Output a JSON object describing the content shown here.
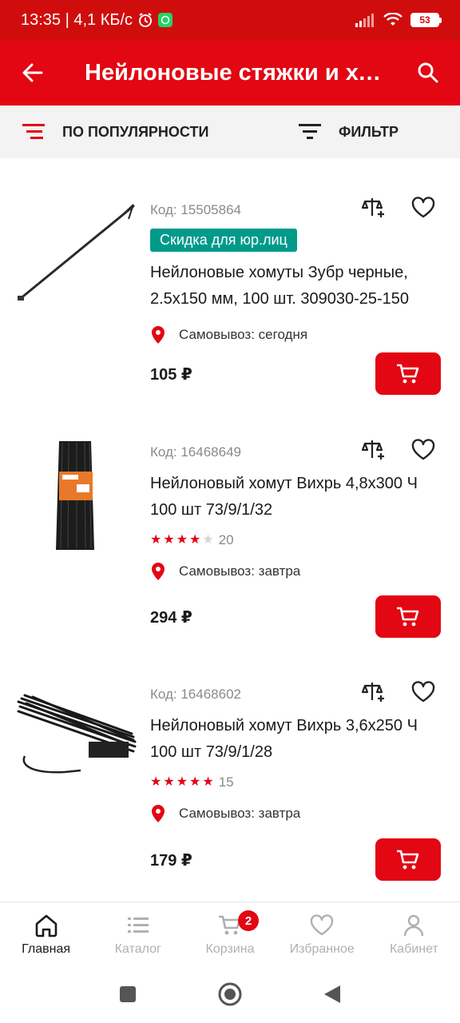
{
  "status_bar": {
    "time_speed": "13:35 | 4,1 КБ/с",
    "battery": "53"
  },
  "app_bar": {
    "title": "Нейлоновые стяжки и хо…",
    "back_icon": "arrow-back-icon",
    "search_icon": "search-icon"
  },
  "sort_bar": {
    "sort_label": "ПО ПОПУЛЯРНОСТИ",
    "filter_label": "ФИЛЬТР"
  },
  "products": [
    {
      "code": "Код: 15505864",
      "badge": "Скидка для юр.лиц",
      "name": "Нейлоновые хомуты Зубр черные, 2.5x150 мм, 100 шт. 309030-25-150",
      "rating": null,
      "reviews": null,
      "pickup": "Самовывоз: сегодня",
      "price": "105 ₽"
    },
    {
      "code": "Код: 16468649",
      "badge": null,
      "name": "Нейлоновый хомут Вихрь 4,8х300 Ч 100 шт 73/9/1/32",
      "rating": 4,
      "reviews": "20",
      "pickup": "Самовывоз: завтра",
      "price": "294 ₽"
    },
    {
      "code": "Код: 16468602",
      "badge": null,
      "name": "Нейлоновый хомут Вихрь 3,6х250 Ч 100 шт 73/9/1/28",
      "rating": 5,
      "reviews": "15",
      "pickup": "Самовывоз: завтра",
      "price": "179 ₽"
    }
  ],
  "bottom_nav": {
    "items": [
      {
        "label": "Главная",
        "icon": "home-icon",
        "active": true
      },
      {
        "label": "Каталог",
        "icon": "catalog-icon",
        "active": false
      },
      {
        "label": "Корзина",
        "icon": "cart-icon",
        "active": false,
        "badge": "2"
      },
      {
        "label": "Избранное",
        "icon": "heart-icon",
        "active": false
      },
      {
        "label": "Кабинет",
        "icon": "user-icon",
        "active": false
      }
    ]
  },
  "colors": {
    "brand_red": "#e30613",
    "status_red": "#d00d0d",
    "badge_teal": "#009a8a"
  }
}
